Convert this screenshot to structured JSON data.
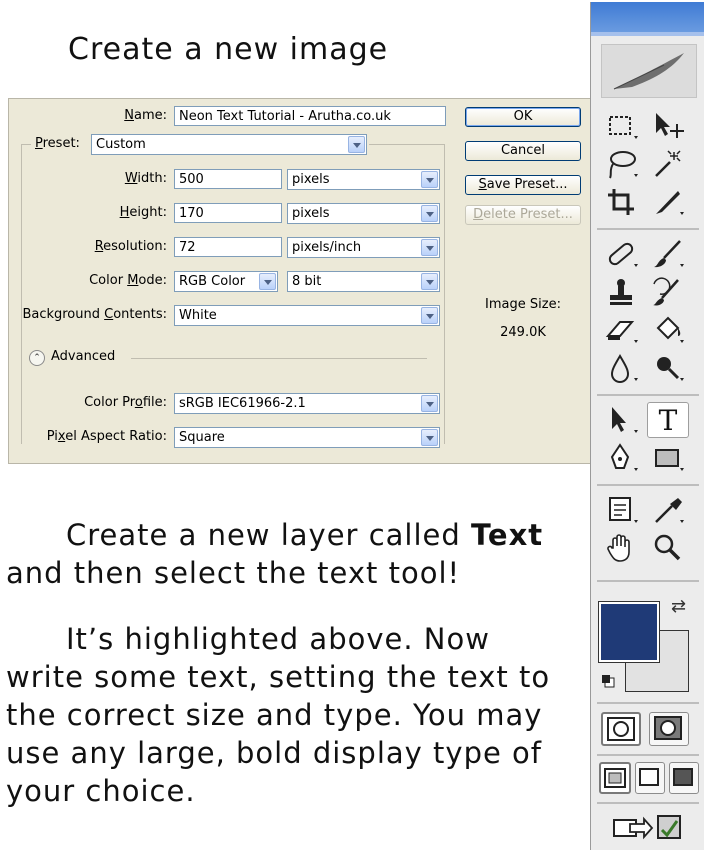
{
  "heading": "Create a new image",
  "dialog": {
    "name_label": "Name:",
    "name_value": "Neon Text Tutorial - Arutha.co.uk",
    "preset_label": "Preset:",
    "preset_value": "Custom",
    "width_label": "Width:",
    "width_value": "500",
    "width_unit": "pixels",
    "height_label": "Height:",
    "height_value": "170",
    "height_unit": "pixels",
    "resolution_label": "Resolution:",
    "resolution_value": "72",
    "resolution_unit": "pixels/inch",
    "color_mode_label": "Color Mode:",
    "color_mode_value": "RGB Color",
    "bit_depth_value": "8 bit",
    "background_label": "Background Contents:",
    "background_value": "White",
    "advanced_label": "Advanced",
    "color_profile_label": "Color Profile:",
    "color_profile_value": "sRGB IEC61966-2.1",
    "pixel_aspect_label": "Pixel Aspect Ratio:",
    "pixel_aspect_value": "Square",
    "ok_label": "OK",
    "cancel_label": "Cancel",
    "save_preset_label": "Save Preset...",
    "delete_preset_label": "Delete Preset...",
    "image_size_label": "Image Size:",
    "image_size_value": "249.0K"
  },
  "para1": {
    "before": "Create a new layer called ",
    "bold": "Text",
    "after": " and then select the text tool!"
  },
  "para2": "It’s highlighted above. Now write some text, setting the text to the correct size and type.  You may use any large, bold display type of your choice.",
  "toolbox": {
    "active_tool": "text-tool",
    "text_tool_glyph": "T",
    "foreground_color": "#1f3a77",
    "background_color": "#e2e2e2",
    "tools": [
      "marquee-icon",
      "move-icon",
      "lasso-icon",
      "magic-wand-icon",
      "crop-icon",
      "slice-icon",
      "healing-brush-icon",
      "brush-icon",
      "clone-stamp-icon",
      "history-brush-icon",
      "eraser-icon",
      "paint-bucket-icon",
      "blur-icon",
      "dodge-icon",
      "path-selection-icon",
      "text-tool-icon",
      "pen-icon",
      "rectangle-shape-icon",
      "notes-icon",
      "eyedropper-icon",
      "hand-icon",
      "zoom-icon"
    ]
  }
}
